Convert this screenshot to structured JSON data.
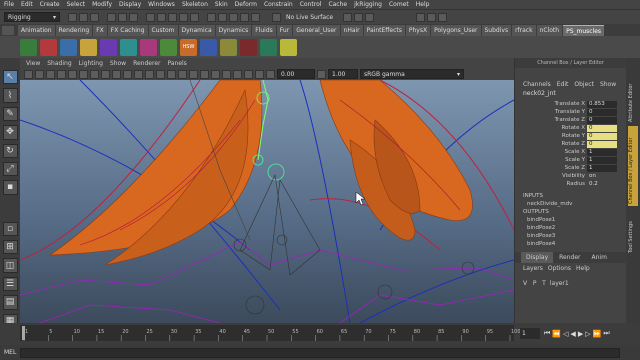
{
  "menubar": {
    "items": [
      "File",
      "Edit",
      "Create",
      "Select",
      "Modify",
      "Display",
      "Windows",
      "Skeleton",
      "Skin",
      "Deform",
      "Constrain",
      "Control",
      "Cache",
      "jkRigging",
      "Comet",
      "Help"
    ]
  },
  "status": {
    "menuset": "Rigging",
    "live_surface": "No Live Surface"
  },
  "shelf_tabs": [
    "Animation",
    "Rendering",
    "FX",
    "FX Caching",
    "Custom",
    "Dynamica",
    "Dynamics",
    "Fluids",
    "Fur",
    "General_User",
    "nHair",
    "PaintEffects",
    "PhysX",
    "Polygons_User",
    "Subdivs",
    "rfrack",
    "nCloth",
    "PS_muscles"
  ],
  "shelf_active": "PS_muscles",
  "shelf_icon_colors": [
    "#3a7c3a",
    "#b23a3a",
    "#3a6ea8",
    "#c8a23a",
    "#6a3ab2",
    "#2f8f8f",
    "#a83a7c",
    "#4a8a3a",
    "#c86a2a",
    "#3a5aa8",
    "#8a8a3a",
    "#7a2a2a",
    "#2a7a5a",
    "#b8b83a"
  ],
  "shelf_icon_text": "HSW",
  "viewport": {
    "menu": [
      "View",
      "Shading",
      "Lighting",
      "Show",
      "Renderer",
      "Panels"
    ],
    "field1": "0.00",
    "field2": "1.00",
    "colorspace": "sRGB gamma"
  },
  "channel_box": {
    "title": "Channel Box / Layer Editor",
    "menu": [
      "Channels",
      "Edit",
      "Object",
      "Show"
    ],
    "node": "neck02_jnt",
    "attrs": [
      {
        "name": "Translate X",
        "value": "0.853",
        "hl": false
      },
      {
        "name": "Translate Y",
        "value": "0",
        "hl": false
      },
      {
        "name": "Translate Z",
        "value": "0",
        "hl": false
      },
      {
        "name": "Rotate X",
        "value": "0",
        "hl": true
      },
      {
        "name": "Rotate Y",
        "value": "0",
        "hl": true
      },
      {
        "name": "Rotate Z",
        "value": "0",
        "hl": true
      },
      {
        "name": "Scale X",
        "value": "1",
        "hl": false
      },
      {
        "name": "Scale Y",
        "value": "1",
        "hl": false
      },
      {
        "name": "Scale Z",
        "value": "1",
        "hl": false
      },
      {
        "name": "Visibility",
        "value": "on",
        "hl": false
      },
      {
        "name": "Radius",
        "value": "0.2",
        "hl": false
      }
    ],
    "inputs_label": "INPUTS",
    "inputs": [
      "neckDivide_mdv"
    ],
    "outputs_label": "OUTPUTS",
    "outputs": [
      "bindPose1",
      "bindPose2",
      "bindPose3",
      "bindPose4"
    ]
  },
  "layer_editor": {
    "tabs": [
      "Display",
      "Render",
      "Anim"
    ],
    "menu": [
      "Layers",
      "Options",
      "Help"
    ],
    "vpt": "V   P   T",
    "layer": "layer1"
  },
  "side_tabs": [
    "Attribute Editor",
    "Channel Box / Layer Editor",
    "Tool Settings"
  ],
  "timeline": {
    "ticks": [
      "1",
      "5",
      "10",
      "15",
      "20",
      "25",
      "30",
      "35",
      "40",
      "45",
      "50",
      "55",
      "60",
      "65",
      "70",
      "75",
      "80",
      "85",
      "90",
      "95",
      "100"
    ],
    "current": "1"
  },
  "cmdline": {
    "label": "MEL"
  }
}
